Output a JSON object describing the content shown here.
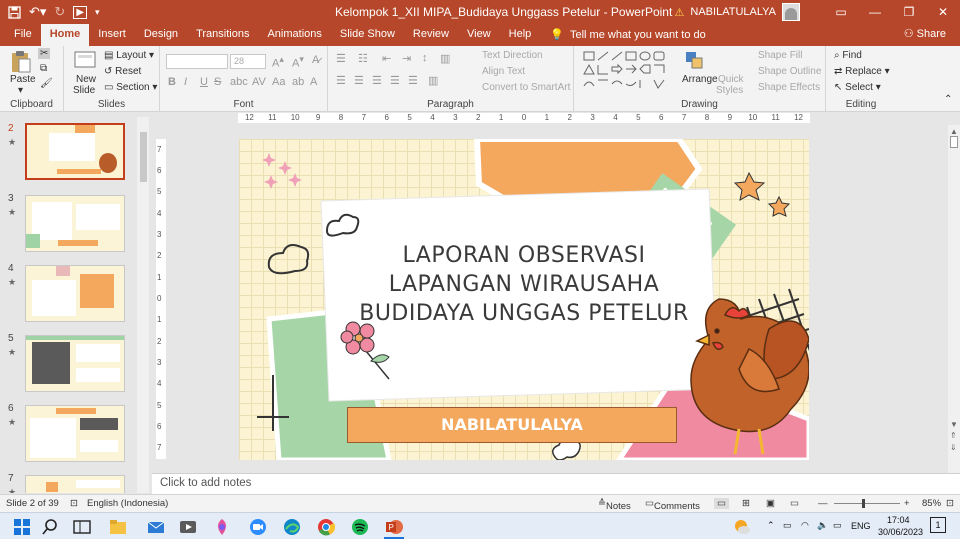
{
  "titlebar": {
    "title": "Kelompok 1_XII MIPA_Budidaya Unggass Petelur  -  PowerPoint",
    "user": "NABILATULALYA",
    "colors": {
      "accent": "#b7472a"
    }
  },
  "tabs": [
    "File",
    "Home",
    "Insert",
    "Design",
    "Transitions",
    "Animations",
    "Slide Show",
    "Review",
    "View",
    "Help"
  ],
  "active_tab": "Home",
  "tell_me": "Tell me what you want to do",
  "share": "Share",
  "ribbon": {
    "clipboard": {
      "label": "Clipboard",
      "paste": "Paste"
    },
    "slides": {
      "label": "Slides",
      "new_slide": "New",
      "new_slide2": "Slide",
      "layout": "Layout",
      "reset": "Reset",
      "section": "Section"
    },
    "font": {
      "label": "Font",
      "size": "28"
    },
    "paragraph": {
      "label": "Paragraph",
      "text_direction": "Text Direction",
      "align_text": "Align Text",
      "convert": "Convert to SmartArt"
    },
    "drawing": {
      "label": "Drawing",
      "arrange": "Arrange",
      "quick": "Quick",
      "styles": "Styles",
      "fill": "Shape Fill",
      "outline": "Shape Outline",
      "effects": "Shape Effects"
    },
    "editing": {
      "label": "Editing",
      "find": "Find",
      "replace": "Replace",
      "select": "Select"
    }
  },
  "thumbnails": [
    {
      "num": "2",
      "selected": true
    },
    {
      "num": "3",
      "selected": false
    },
    {
      "num": "4",
      "selected": false
    },
    {
      "num": "5",
      "selected": false
    },
    {
      "num": "6",
      "selected": false
    },
    {
      "num": "7",
      "selected": false
    }
  ],
  "ruler_h": [
    "12",
    "11",
    "10",
    "9",
    "8",
    "7",
    "6",
    "5",
    "4",
    "3",
    "2",
    "1",
    "0",
    "1",
    "2",
    "3",
    "4",
    "5",
    "6",
    "7",
    "8",
    "9",
    "10",
    "11",
    "12"
  ],
  "ruler_v": [
    "7",
    "6",
    "5",
    "4",
    "3",
    "2",
    "1",
    "0",
    "1",
    "2",
    "3",
    "4",
    "5",
    "6",
    "7"
  ],
  "slide": {
    "title_lines": [
      "LAPORAN OBSERVASI",
      "LAPANGAN WIRAUSAHA",
      "BUDIDAYA UNGGAS PETELUR"
    ],
    "name": "NABILATULALYA"
  },
  "notes_placeholder": "Click to add notes",
  "statusbar": {
    "slide_count": "Slide 2 of 39",
    "language": "English (Indonesia)",
    "notes": "Notes",
    "comments": "Comments",
    "zoom": "85%"
  },
  "taskbar": {
    "lang": "ENG",
    "time": "17:04",
    "date": "30/06/2023",
    "badge": "1"
  }
}
